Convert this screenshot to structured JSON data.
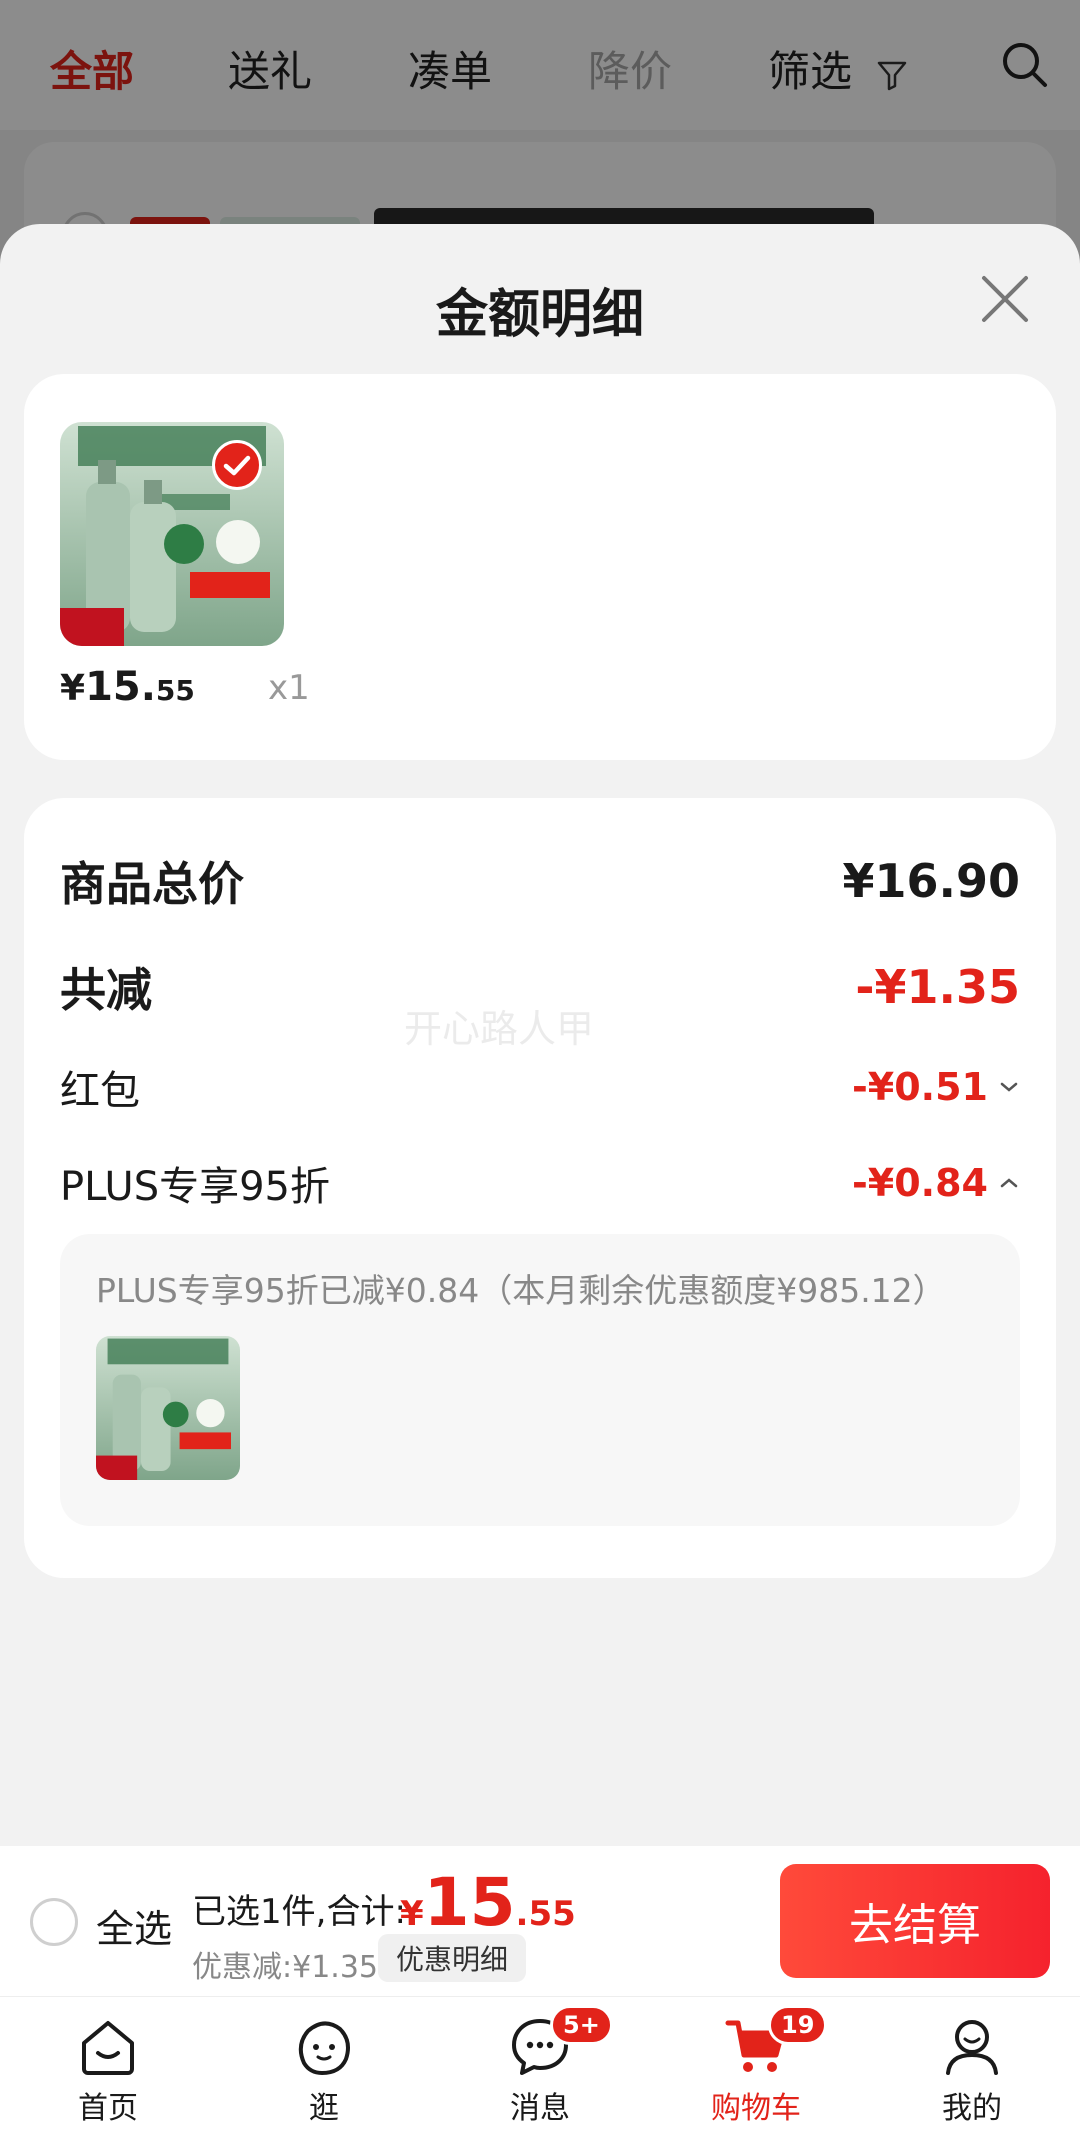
{
  "background": {
    "tabs": [
      {
        "label": "全部",
        "state": "active"
      },
      {
        "label": "送礼",
        "state": "normal"
      },
      {
        "label": "凑单",
        "state": "normal"
      },
      {
        "label": "降价",
        "state": "disabled"
      },
      {
        "label": "筛选",
        "state": "normal"
      }
    ]
  },
  "sheet": {
    "title": "金额明细",
    "product": {
      "price_symbol": "¥",
      "price_int": "15.",
      "price_dec": "55",
      "quantity": "x1"
    },
    "summary": {
      "total_label": "商品总价",
      "total_value": "¥16.90",
      "reduce_label": "共减",
      "reduce_value": "-¥1.35",
      "watermark": "开心路人甲",
      "redpacket_label": "红包",
      "redpacket_value": "-¥0.51",
      "plus_label": "PLUS专享95折",
      "plus_value": "-¥0.84",
      "plus_detail": "PLUS专享95折已减¥0.84（本月剩余优惠额度¥985.12）"
    }
  },
  "action_bar": {
    "select_all": "全选",
    "selected_info": "已选1件,合计:",
    "total_symbol": "¥",
    "total_int": "15",
    "total_dec": ".55",
    "discount_info": "优惠减:¥1.35",
    "discount_detail": "优惠明细",
    "checkout": "去结算"
  },
  "bottom_nav": {
    "items": [
      {
        "label": "首页",
        "icon": "home-icon"
      },
      {
        "label": "逛",
        "icon": "browse-icon"
      },
      {
        "label": "消息",
        "icon": "message-icon",
        "badge": "5+"
      },
      {
        "label": "购物车",
        "icon": "cart-icon",
        "badge": "19",
        "active": true
      },
      {
        "label": "我的",
        "icon": "profile-icon"
      }
    ]
  },
  "colors": {
    "accent": "#e2231a",
    "overlay": "rgba(0,0,0,0.45)",
    "background": "#f2f2f2"
  }
}
